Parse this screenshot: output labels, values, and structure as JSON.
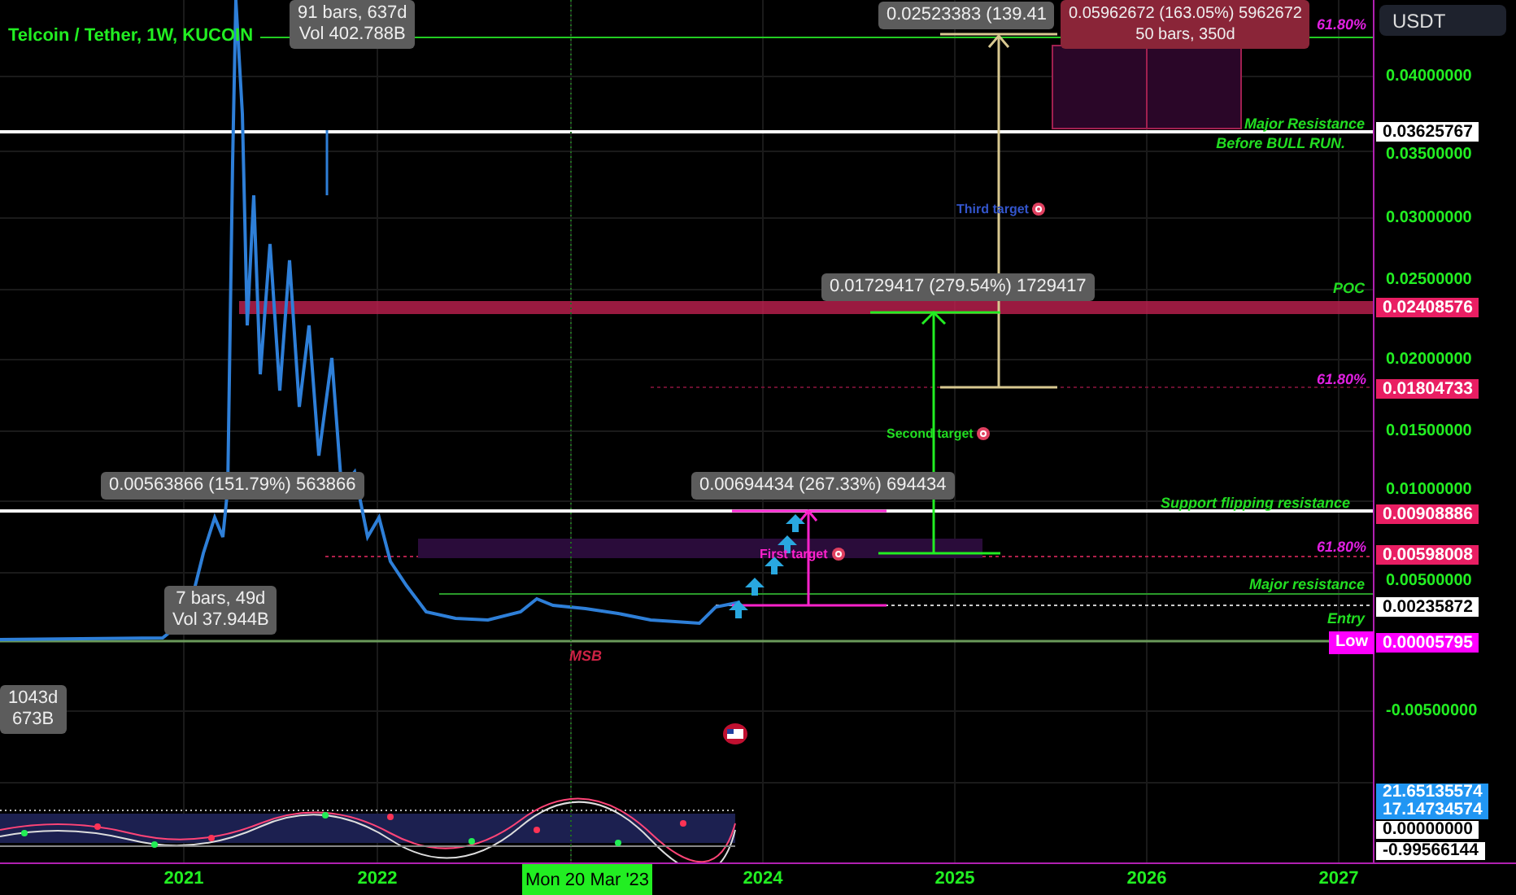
{
  "header": {
    "title": "Telcoin / Tether, 1W, KUCOIN",
    "currency": "USDT"
  },
  "annotations": [
    {
      "kind": "measure",
      "lines": [
        "91 bars, 637d",
        "Vol 402.788B"
      ]
    },
    {
      "kind": "measure",
      "lines": [
        "0.02523383 (139.41"
      ]
    },
    {
      "kind": "measure_loss",
      "lines": [
        "0.05962672 (163.05%) 5962672",
        "50 bars, 350d"
      ]
    },
    {
      "kind": "label",
      "text": "61.80%",
      "color": "#e020e0"
    },
    {
      "kind": "label",
      "text": "Major Resistance",
      "color": "#22dd22"
    },
    {
      "kind": "label",
      "text": "Before BULL RUN.",
      "color": "#22dd22"
    },
    {
      "kind": "target",
      "text": "Third target",
      "color": "#3355cc"
    },
    {
      "kind": "measure",
      "lines": [
        "0.01729417 (279.54%) 1729417"
      ]
    },
    {
      "kind": "label",
      "text": "POC",
      "color": "#22dd22"
    },
    {
      "kind": "label",
      "text": "61.80%",
      "color": "#e020e0"
    },
    {
      "kind": "target",
      "text": "Second target",
      "color": "#22dd22"
    },
    {
      "kind": "measure",
      "lines": [
        "0.00563866 (151.79%) 563866"
      ]
    },
    {
      "kind": "measure",
      "lines": [
        "0.00694434 (267.33%) 694434"
      ]
    },
    {
      "kind": "label",
      "text": "Support flipping resistance",
      "color": "#22dd22"
    },
    {
      "kind": "label",
      "text": "61.80%",
      "color": "#e020e0"
    },
    {
      "kind": "target",
      "text": "First target",
      "color": "#ff22cc"
    },
    {
      "kind": "label",
      "text": "Major resistance",
      "color": "#22dd22"
    },
    {
      "kind": "measure",
      "lines": [
        "7 bars, 49d",
        "Vol 37.944B"
      ]
    },
    {
      "kind": "label",
      "text": "Entry",
      "color": "#22dd22"
    },
    {
      "kind": "label",
      "text": "MSB",
      "color": "#cc2244"
    },
    {
      "kind": "measure",
      "lines": [
        "1043d",
        "673B"
      ]
    }
  ],
  "price_axis": {
    "ticks": [
      "0.04000000",
      "0.03500000",
      "0.03000000",
      "0.02500000",
      "0.02000000",
      "0.01500000",
      "0.01000000",
      "0.00500000",
      "-0.00500000"
    ],
    "tags": [
      {
        "text": "0.03625767",
        "color": "#ffffff"
      },
      {
        "text": "0.02408576",
        "color": "#e91e63"
      },
      {
        "text": "0.01804733",
        "color": "#e91e63"
      },
      {
        "text": "0.00908886",
        "color": "#e91e63"
      },
      {
        "text": "0.00598008",
        "color": "#e91e63"
      },
      {
        "text": "0.00235872",
        "color": "#ffffff"
      }
    ],
    "low": {
      "label": "Low",
      "value": "0.00005795",
      "color": "#ff00ff"
    },
    "indicator_tags": [
      {
        "text": "21.65135574",
        "color": "#2196f3"
      },
      {
        "text": "17.14734574",
        "color": "#2196f3"
      },
      {
        "text": "0.00000000",
        "color": "#ffffff"
      },
      {
        "text": "-0.99566144",
        "color": "#ffffff"
      }
    ]
  },
  "time_axis": {
    "labels": [
      "2021",
      "2022",
      "2024",
      "2025",
      "2026",
      "2027"
    ],
    "crosshair": "Mon 20 Mar '23"
  }
}
